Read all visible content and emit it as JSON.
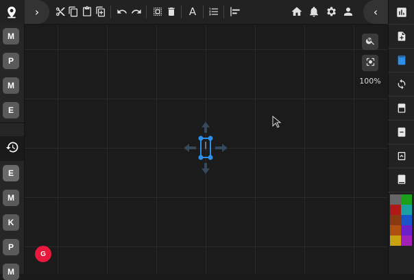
{
  "toolbar": {
    "expand_label": "›",
    "font_label": "A",
    "collapse_label": "‹"
  },
  "left_sidebar": {
    "top_items": [
      "M",
      "P",
      "M",
      "E"
    ],
    "bottom_items": [
      "E",
      "M",
      "K",
      "P",
      "M"
    ]
  },
  "zoom": {
    "level": "100%"
  },
  "user": {
    "avatar_letter": "G"
  },
  "canvas": {
    "selected_text": "|"
  },
  "colors": {
    "selection": "#2f8fe8",
    "avatar": "#e8193c",
    "palette": [
      [
        "#666666",
        "#1aa01a"
      ],
      [
        "#b01818",
        "#1aa0a0"
      ],
      [
        "#8a3a10",
        "#1a55c8"
      ],
      [
        "#b05010",
        "#6a20c8"
      ],
      [
        "#c8a010",
        "#a020b8"
      ]
    ]
  },
  "icons": {
    "top_left": "map-pin-icon",
    "history": "history-icon",
    "toolbar": [
      "cut-icon",
      "copy-icon",
      "paste-icon",
      "duplicate-icon",
      "undo-icon",
      "redo-icon",
      "select-all-icon",
      "delete-icon",
      "font-icon",
      "list-icon",
      "align-left-icon"
    ],
    "top_right": [
      "home-icon",
      "bell-icon",
      "gear-icon",
      "user-icon"
    ],
    "right_sidebar": [
      "chart-icon",
      "add-page-icon",
      "page-icon",
      "sync-icon",
      "layout-top-icon",
      "minus-box-icon",
      "chevron-up-box-icon",
      "layout-bottom-icon"
    ],
    "zoom": [
      "zoom-in-icon",
      "focus-icon"
    ]
  }
}
